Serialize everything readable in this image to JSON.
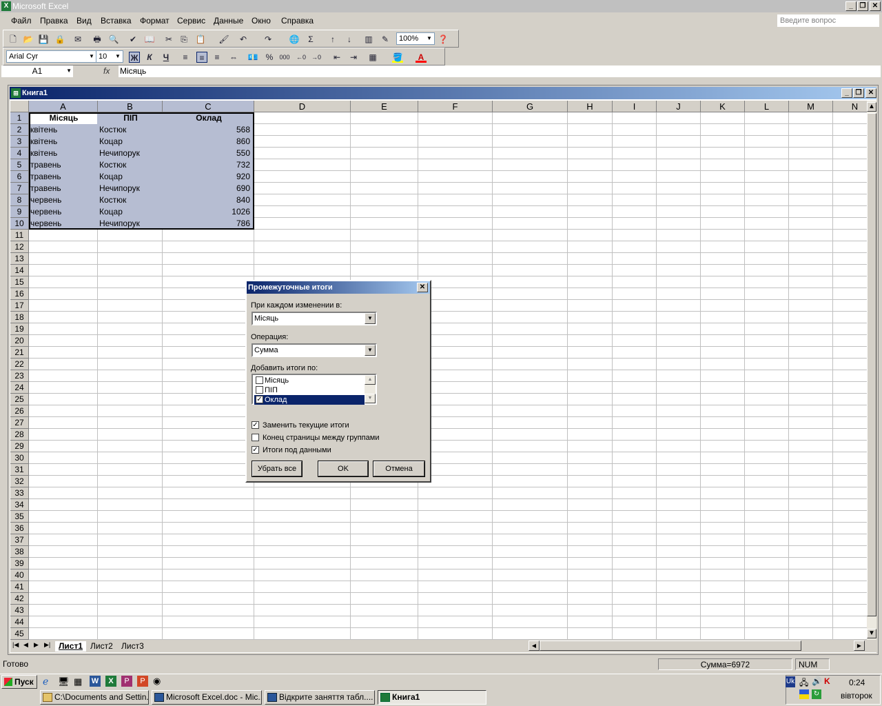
{
  "app": {
    "title": "Microsoft Excel",
    "logo_letter": "X"
  },
  "menu": [
    "Файл",
    "Правка",
    "Вид",
    "Вставка",
    "Формат",
    "Сервис",
    "Данные",
    "Окно",
    "Справка"
  ],
  "ask_placeholder": "Введите вопрос",
  "toolbar": {
    "zoom": "100%",
    "font": "Arial Cyr",
    "size": "10",
    "bold": "Ж",
    "italic": "К",
    "underline": "Ч",
    "percent": "%",
    "thousands": "000"
  },
  "formula_bar": {
    "cell_ref": "A1",
    "fx": "fx",
    "value": "Місяць"
  },
  "workbook": {
    "title": "Книга1"
  },
  "columns": [
    "A",
    "B",
    "C",
    "D",
    "E",
    "F",
    "G",
    "H",
    "I",
    "J",
    "K",
    "L",
    "M",
    "N"
  ],
  "rows": [
    "1",
    "2",
    "3",
    "4",
    "5",
    "6",
    "7",
    "8",
    "9",
    "10",
    "11",
    "12",
    "13",
    "14",
    "15",
    "16",
    "17",
    "18",
    "19",
    "20",
    "21",
    "22",
    "23",
    "24",
    "25",
    "26",
    "27",
    "28",
    "29",
    "30",
    "31",
    "32",
    "33",
    "34",
    "35",
    "36",
    "37",
    "38",
    "39",
    "40",
    "41",
    "42",
    "43",
    "44",
    "45"
  ],
  "table": {
    "headers": [
      "Місяць",
      "ПІП",
      "Оклад"
    ],
    "data": [
      [
        "квітень",
        "Костюк",
        "568"
      ],
      [
        "квітень",
        "Коцар",
        "860"
      ],
      [
        "квітень",
        "Нечипорук",
        "550"
      ],
      [
        "травень",
        "Костюк",
        "732"
      ],
      [
        "травень",
        "Коцар",
        "920"
      ],
      [
        "травень",
        "Нечипорук",
        "690"
      ],
      [
        "червень",
        "Костюк",
        "840"
      ],
      [
        "червень",
        "Коцар",
        "1026"
      ],
      [
        "червень",
        "Нечипорук",
        "786"
      ]
    ]
  },
  "sheets": [
    "Лист1",
    "Лист2",
    "Лист3"
  ],
  "dialog": {
    "title": "Промежуточные итоги",
    "change_label": "При каждом изменении в:",
    "change_value": "Місяць",
    "op_label": "Операция:",
    "op_value": "Сумма",
    "add_label": "Добавить итоги по:",
    "fields": [
      {
        "label": "Місяць",
        "checked": false
      },
      {
        "label": "ПІП",
        "checked": false
      },
      {
        "label": "Оклад",
        "checked": true
      }
    ],
    "replace_label": "Заменить текущие итоги",
    "pagebreak_label": "Конец страницы между группами",
    "below_label": "Итоги под данными",
    "remove_all": "Убрать все",
    "ok": "OK",
    "cancel": "Отмена"
  },
  "status": {
    "ready": "Готово",
    "sum": "Сумма=6972",
    "num": "NUM"
  },
  "taskbar": {
    "start": "Пуск",
    "buttons": [
      "C:\\Documents and Settin...",
      "Microsoft Excel.doc - Mic...",
      "Відкрите заняття табл....",
      "Книга1"
    ],
    "lang": "Uk",
    "time": "0:24",
    "day": "вівторок"
  }
}
